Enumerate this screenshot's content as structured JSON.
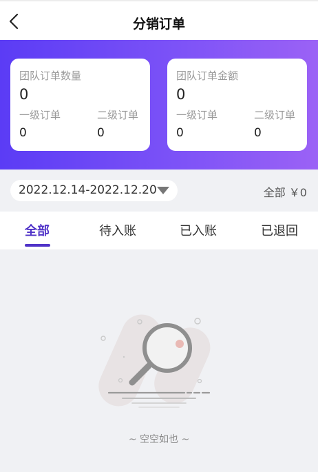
{
  "header": {
    "title": "分销订单"
  },
  "stats": {
    "count_card": {
      "label": "团队订单数量",
      "total": "0",
      "level1_label": "一级订单",
      "level1_value": "0",
      "level2_label": "二级订单",
      "level2_value": "0"
    },
    "amount_card": {
      "label": "团队订单金额",
      "total": "0",
      "level1_label": "一级订单",
      "level1_value": "0",
      "level2_label": "二级订单",
      "level2_value": "0"
    }
  },
  "filter": {
    "date_range": "2022.12.14-2022.12.20",
    "summary": "全部 ￥0"
  },
  "tabs": [
    {
      "label": "全部",
      "active": true
    },
    {
      "label": "待入账",
      "active": false
    },
    {
      "label": "已入账",
      "active": false
    },
    {
      "label": "已退回",
      "active": false
    }
  ],
  "empty_state": {
    "text": "~ 空空如也 ~"
  },
  "colors": {
    "accent": "#5033c8",
    "banner_start": "#5b3cf5",
    "banner_end": "#9b62f6"
  }
}
